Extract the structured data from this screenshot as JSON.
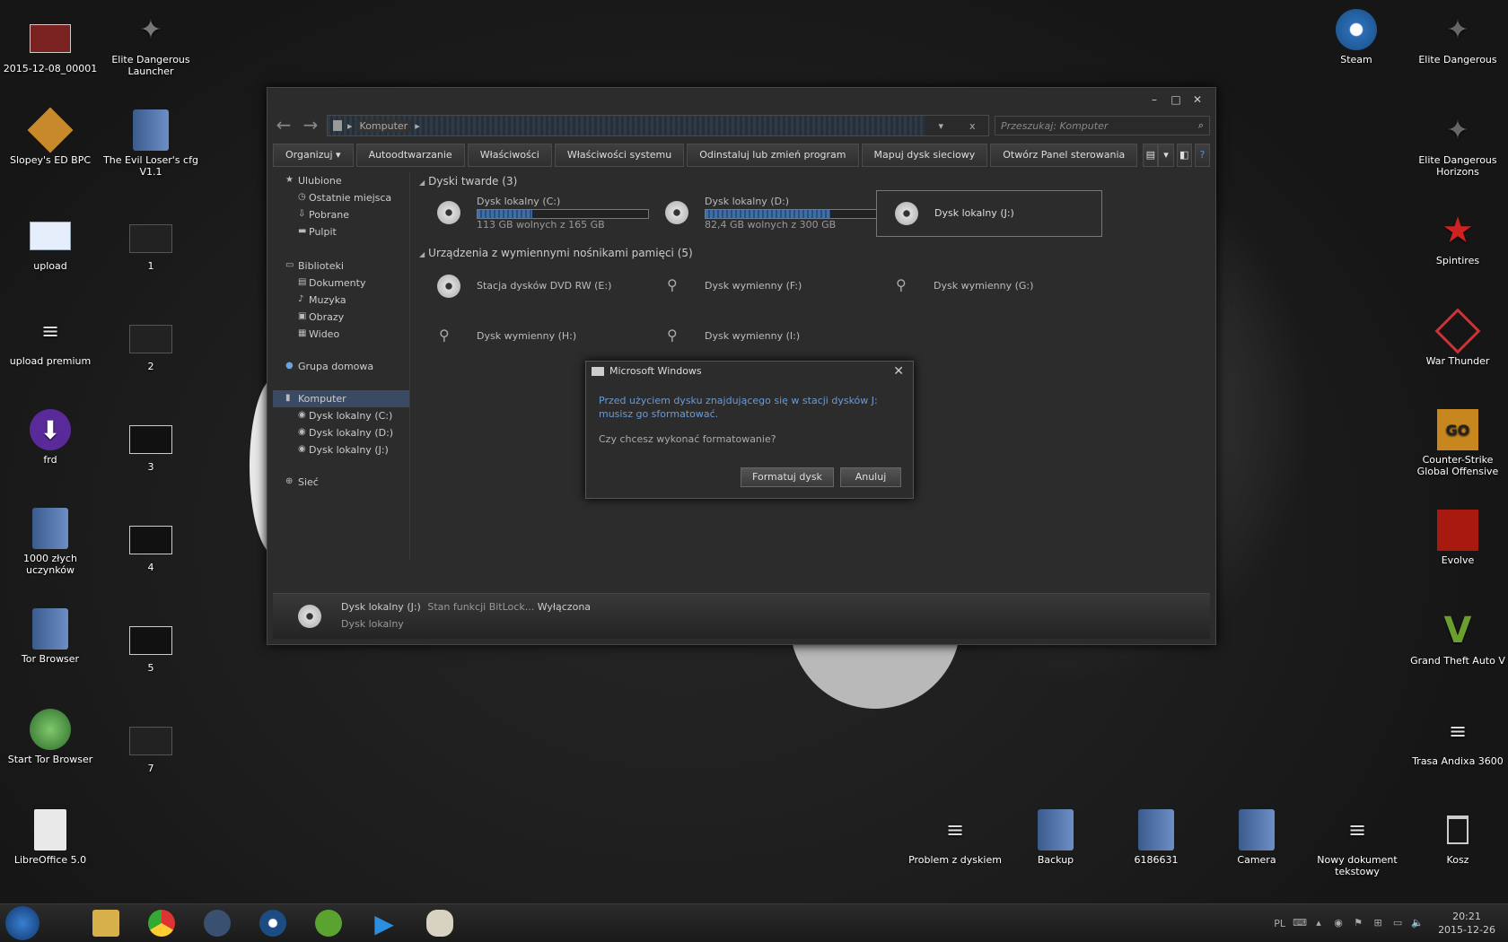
{
  "desktop": {
    "left_col1": [
      {
        "label": "2015-12-08_00001",
        "icon": "screenshot-icon"
      },
      {
        "label": "Slopey's ED BPC",
        "icon": "elite-bpc-icon"
      },
      {
        "label": "upload",
        "icon": "file-icon"
      },
      {
        "label": "upload premium",
        "icon": "text-file-icon"
      },
      {
        "label": "frd",
        "icon": "download-icon"
      },
      {
        "label": "1000 złych uczynków",
        "icon": "folder-icon"
      },
      {
        "label": "Tor Browser",
        "icon": "folder-icon"
      },
      {
        "label": "Start Tor Browser",
        "icon": "tor-globe-icon"
      },
      {
        "label": "LibreOffice 5.0",
        "icon": "document-icon"
      }
    ],
    "left_col2": [
      {
        "label": "Elite Dangerous Launcher",
        "icon": "elite-icon"
      },
      {
        "label": "The Evil Loser's cfg V1.1",
        "icon": "folder-icon"
      },
      {
        "label": "1",
        "icon": "screenshot-icon"
      },
      {
        "label": "2",
        "icon": "screenshot-icon"
      },
      {
        "label": "3",
        "icon": "screenshot-icon"
      },
      {
        "label": "4",
        "icon": "screenshot-icon"
      },
      {
        "label": "5",
        "icon": "screenshot-icon"
      },
      {
        "label": "7",
        "icon": "screenshot-icon"
      }
    ],
    "right_col1": [
      {
        "label": "Steam",
        "icon": "steam-icon"
      }
    ],
    "right_col2": [
      {
        "label": "Elite Dangerous",
        "icon": "elite-icon"
      },
      {
        "label": "Elite Dangerous Horizons",
        "icon": "elite-icon"
      },
      {
        "label": "Spintires",
        "icon": "star-icon"
      },
      {
        "label": "War Thunder",
        "icon": "war-thunder-icon"
      },
      {
        "label": "Counter-Strike Global Offensive",
        "icon": "csgo-icon"
      },
      {
        "label": "Evolve",
        "icon": "evolve-icon"
      },
      {
        "label": "Grand Theft Auto V",
        "icon": "gta-icon"
      },
      {
        "label": "Trasa Andixa 3600",
        "icon": "text-file-icon"
      }
    ],
    "bottom_row": [
      {
        "label": "Problem z dyskiem",
        "icon": "text-file-icon"
      },
      {
        "label": "Backup",
        "icon": "folder-icon"
      },
      {
        "label": "6186631",
        "icon": "folder-icon"
      },
      {
        "label": "Camera",
        "icon": "folder-icon"
      },
      {
        "label": "Nowy dokument tekstowy",
        "icon": "text-file-icon"
      },
      {
        "label": "Kosz",
        "icon": "recycle-bin-icon"
      }
    ]
  },
  "explorer": {
    "address": "Komputer",
    "search_placeholder": "Przeszukaj: Komputer",
    "toolbar": [
      "Organizuj ▾",
      "Autoodtwarzanie",
      "Właściwości",
      "Właściwości systemu",
      "Odinstaluj lub zmień program",
      "Mapuj dysk sieciowy",
      "Otwórz Panel sterowania"
    ],
    "sidebar": {
      "favorites": {
        "label": "Ulubione",
        "items": [
          "Ostatnie miejsca",
          "Pobrane",
          "Pulpit"
        ]
      },
      "libraries": {
        "label": "Biblioteki",
        "items": [
          "Dokumenty",
          "Muzyka",
          "Obrazy",
          "Wideo"
        ]
      },
      "homegroup": "Grupa domowa",
      "computer": {
        "label": "Komputer",
        "items": [
          "Dysk lokalny (C:)",
          "Dysk lokalny (D:)",
          "Dysk lokalny (J:)"
        ]
      },
      "network": "Sieć"
    },
    "hard_drives": {
      "header": "Dyski twarde (3)",
      "drives": [
        {
          "name": "Dysk lokalny (C:)",
          "free": "113 GB wolnych z 165 GB",
          "used_fraction": 0.32
        },
        {
          "name": "Dysk lokalny (D:)",
          "free": "82,4 GB wolnych z 300 GB",
          "used_fraction": 0.73
        },
        {
          "name": "Dysk lokalny (J:)"
        }
      ]
    },
    "removable": {
      "header": "Urządzenia z wymiennymi nośnikami pamięci (5)",
      "devices": [
        "Stacja dysków DVD RW (E:)",
        "Dysk wymienny (F:)",
        "Dysk wymienny (G:)",
        "Dysk wymienny (H:)",
        "Dysk wymienny (I:)"
      ]
    },
    "status": {
      "name": "Dysk lokalny (J:)",
      "bitlocker_label": "Stan funkcji BitLock...",
      "bitlocker_value": "Wyłączona",
      "type": "Dysk lokalny"
    }
  },
  "dialog": {
    "title": "Microsoft Windows",
    "message": "Przed użyciem dysku znajdującego się w stacji dysków J: musisz go sformatować.",
    "question": "Czy chcesz wykonać formatowanie?",
    "ok": "Formatuj dysk",
    "cancel": "Anuluj"
  },
  "taskbar": {
    "lang": "PL",
    "time": "20:21",
    "date": "2015-12-26"
  }
}
